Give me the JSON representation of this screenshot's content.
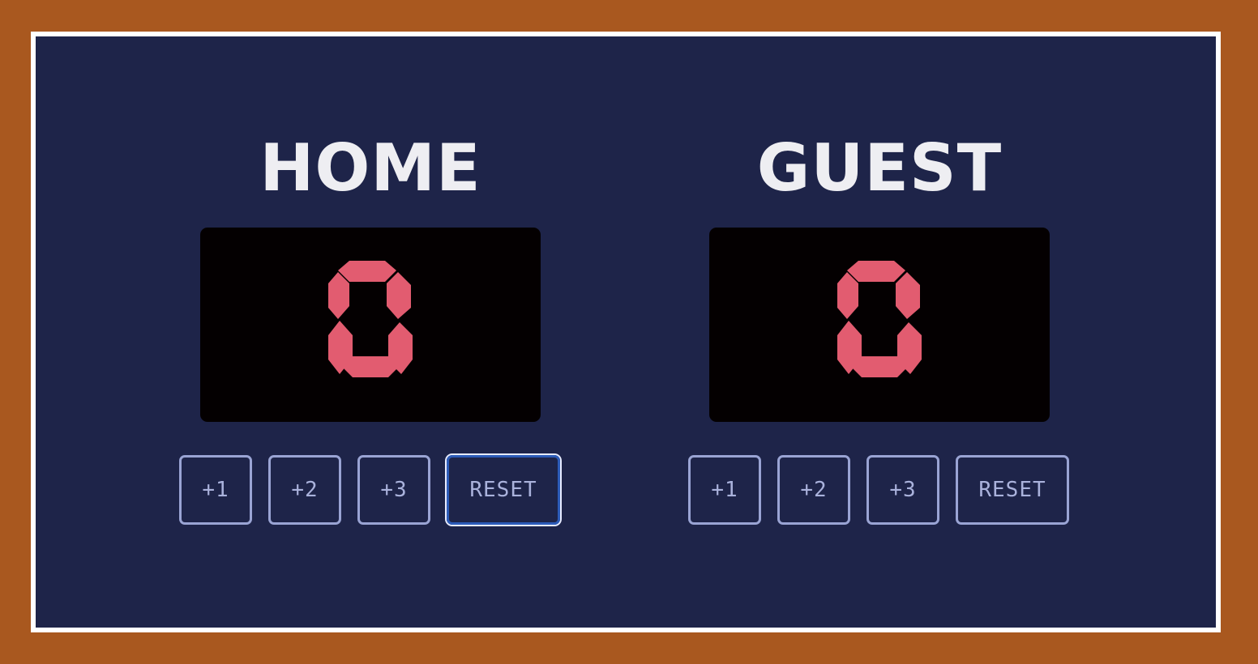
{
  "home": {
    "name": "HOME",
    "score": 0,
    "buttons": {
      "plus1": "+1",
      "plus2": "+2",
      "plus3": "+3",
      "reset": "RESET"
    }
  },
  "guest": {
    "name": "GUEST",
    "score": 0,
    "buttons": {
      "plus1": "+1",
      "plus2": "+2",
      "plus3": "+3",
      "reset": "RESET"
    }
  },
  "colors": {
    "frame": "#a9581f",
    "board": "#1e2449",
    "display": "#040001",
    "segment_on": "#e25c70",
    "button_text": "#aab2dc"
  }
}
